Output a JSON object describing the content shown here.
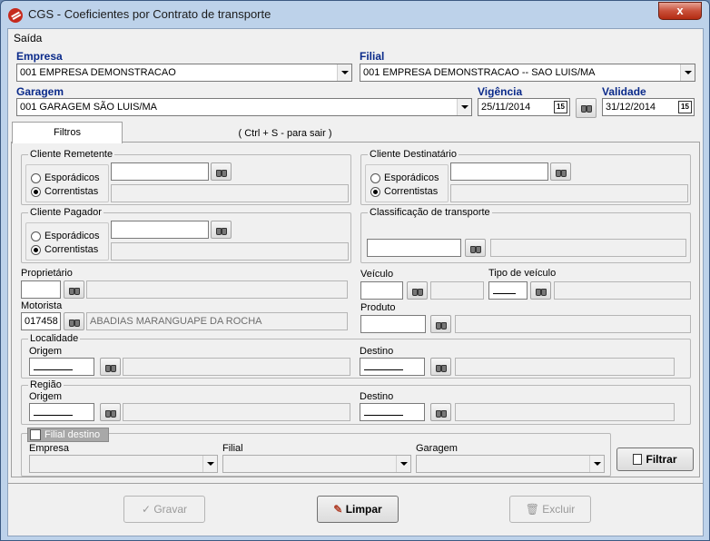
{
  "window": {
    "title": "CGS - Coeficientes por Contrato de transporte",
    "close_label": "x"
  },
  "menu": {
    "item": "Saída"
  },
  "header": {
    "empresa_label": "Empresa",
    "empresa_value": "001 EMPRESA DEMONSTRACAO",
    "filial_label": "Filial",
    "filial_value": "001 EMPRESA DEMONSTRACAO -- SAO LUIS/MA",
    "garagem_label": "Garagem",
    "garagem_value": "001 GARAGEM SÃO LUIS/MA",
    "vigencia_label": "Vigência",
    "vigencia_value": "25/11/2014",
    "validade_label": "Validade",
    "validade_value": "31/12/2014",
    "calendar_glyph": "15"
  },
  "tabs": [
    {
      "label": "Filtros"
    },
    {
      "label": "( Ctrl + S - para sair )"
    }
  ],
  "filters": {
    "cliente_remetente": {
      "title": "Cliente Remetente",
      "opt1": "Esporádicos",
      "opt2": "Correntistas"
    },
    "cliente_destinatario": {
      "title": "Cliente Destinatário",
      "opt1": "Esporádicos",
      "opt2": "Correntistas"
    },
    "cliente_pagador": {
      "title": "Cliente Pagador",
      "opt1": "Esporádicos",
      "opt2": "Correntistas"
    },
    "classificacao": {
      "title": "Classificação de transporte"
    },
    "proprietario_label": "Proprietário",
    "veiculo_label": "Veículo",
    "tipo_veiculo_label": "Tipo de veículo",
    "motorista_label": "Motorista",
    "motorista_code": "017458",
    "motorista_name": "ABADIAS MARANGUAPE DA ROCHA",
    "produto_label": "Produto",
    "localidade": {
      "title": "Localidade",
      "origem": "Origem",
      "destino": "Destino"
    },
    "regiao": {
      "title": "Região",
      "origem": "Origem",
      "destino": "Destino"
    },
    "filial_destino": {
      "label": "Filial destino",
      "empresa": "Empresa",
      "filial": "Filial",
      "garagem": "Garagem"
    },
    "filtrar_label": "Filtrar"
  },
  "actions": {
    "gravar": "Gravar",
    "limpar": "Limpar",
    "excluir": "Excluir"
  }
}
